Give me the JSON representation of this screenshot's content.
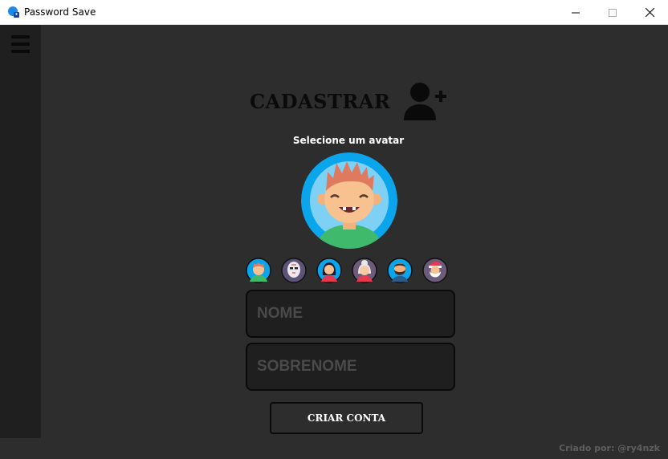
{
  "window": {
    "title": "Password Save"
  },
  "sidebar": {
    "menu_icon": "hamburger-icon"
  },
  "header": {
    "title": "CADASTRAR",
    "icon": "add-user-icon"
  },
  "avatar_section": {
    "label": "Selecione um avatar",
    "selected": "boy-red-hair",
    "options": [
      "boy-red-hair",
      "hockey-mask",
      "girl-dark-hair",
      "old-woman",
      "bearded-man",
      "santa-claus"
    ]
  },
  "form": {
    "nome_placeholder": "NOME",
    "sobrenome_placeholder": "SOBRENOME",
    "submit_label": "CRIAR CONTA"
  },
  "footer": {
    "credit": "Criado por: @ry4nzk"
  }
}
